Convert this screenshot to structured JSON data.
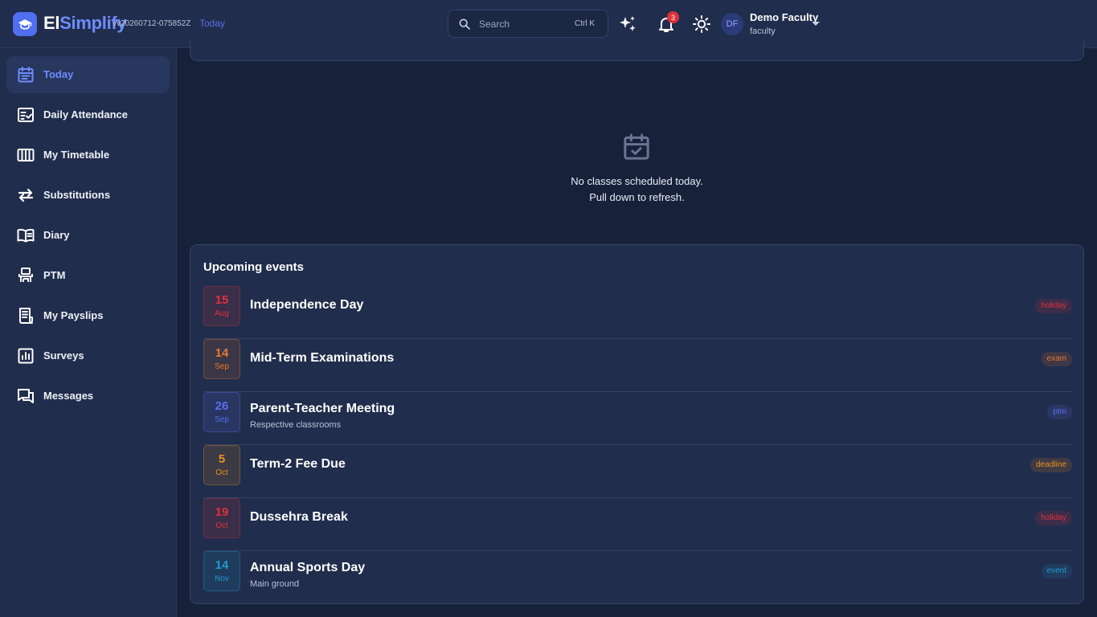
{
  "header": {
    "brand_part1": "El",
    "brand_part2": "Simplify",
    "version": "vv20260712-075852Z",
    "today_link": "Today",
    "search_placeholder": "Search",
    "search_shortcut": "Ctrl K",
    "notification_count": "3",
    "user_initials": "DF",
    "user_name": "Demo Faculty",
    "user_role": "faculty"
  },
  "sidebar": {
    "items": [
      {
        "label": "Today",
        "icon": "calendar-icon",
        "active": true
      },
      {
        "label": "Daily Attendance",
        "icon": "attendance-checklist-icon"
      },
      {
        "label": "My Timetable",
        "icon": "timetable-columns-icon"
      },
      {
        "label": "Substitutions",
        "icon": "swap-arrows-icon"
      },
      {
        "label": "Diary",
        "icon": "book-icon"
      },
      {
        "label": "PTM",
        "icon": "meeting-icon"
      },
      {
        "label": "My Payslips",
        "icon": "receipt-icon"
      },
      {
        "label": "Surveys",
        "icon": "bar-chart-icon"
      },
      {
        "label": "Messages",
        "icon": "chat-bubbles-icon"
      }
    ]
  },
  "empty_state": {
    "line1": "No classes scheduled today.",
    "line2": "Pull down to refresh."
  },
  "events": {
    "title": "Upcoming events",
    "items": [
      {
        "day": "15",
        "month": "Aug",
        "title": "Independence Day",
        "subtitle": "",
        "tag": "holiday",
        "color": "#e0313b"
      },
      {
        "day": "14",
        "month": "Sep",
        "title": "Mid-Term Examinations",
        "subtitle": "",
        "tag": "exam",
        "color": "#e8772e"
      },
      {
        "day": "26",
        "month": "Sep",
        "title": "Parent-Teacher Meeting",
        "subtitle": "Respective classrooms",
        "tag": "ptm",
        "color": "#5b6ff0"
      },
      {
        "day": "5",
        "month": "Oct",
        "title": "Term-2 Fee Due",
        "subtitle": "",
        "tag": "deadline",
        "color": "#e8901e"
      },
      {
        "day": "19",
        "month": "Oct",
        "title": "Dussehra Break",
        "subtitle": "",
        "tag": "holiday",
        "color": "#e0313b"
      },
      {
        "day": "14",
        "month": "Nov",
        "title": "Annual Sports Day",
        "subtitle": "Main ground",
        "tag": "event",
        "color": "#1e9bd0"
      }
    ]
  }
}
